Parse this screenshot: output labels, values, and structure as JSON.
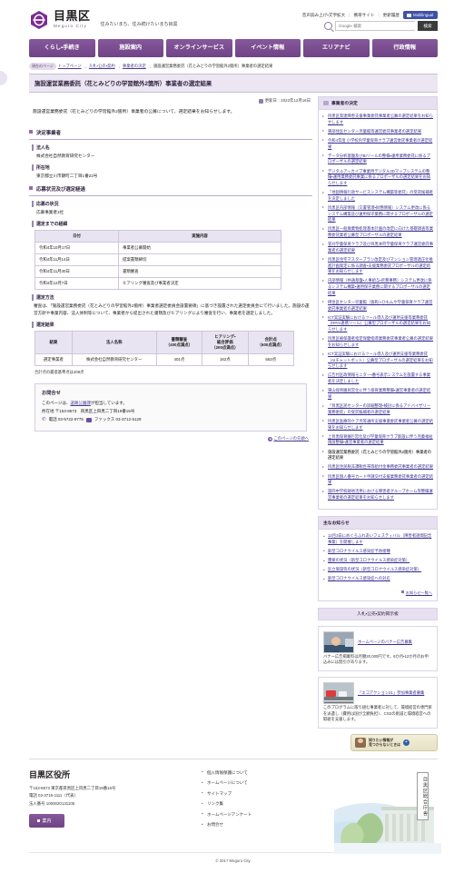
{
  "header": {
    "logo_ja": "目黒区",
    "logo_en": "Meguro City",
    "tagline": "住みたいまち、住み続けたいまち目黒",
    "utils": [
      "音声読み上げ・文字拡大",
      "携帯サイト",
      "更新履歴"
    ],
    "multilingual_label": "Multilingual",
    "search_placeholder": "Google 検索",
    "search_button": "検索"
  },
  "gnav": [
    "くらし・手続き",
    "施設案内",
    "オンラインサービス",
    "イベント情報",
    "エリアナビ",
    "行政情報"
  ],
  "breadcrumb": {
    "badge": "現在のページ",
    "items": [
      "トップページ",
      "入札・公売・契約",
      "事業者の決定"
    ],
    "current": "施設運営業務委託（花とみどりの学習館外2箇所）事業者の選定結果"
  },
  "page_title": "施設運営業務委託（花とみどりの学習館外2箇所）事業者の選定結果",
  "main": {
    "updated_label": "更新日：2022年12月16日",
    "lead": "施設運営業務委託（花とみどりの学習館外2箇所）事業者の公募について、選定結果をお知らせします。",
    "section1_title": "決定事業者",
    "corp_name_label": "法人名",
    "corp_name_value": "株式会社自然教育研究センター",
    "address_label": "所在地",
    "address_value": "東京都立川市錦町二丁目1番22号",
    "section2_title": "応募状況及び選定経過",
    "apply_label": "応募の状況",
    "apply_value": "応募事業者1社",
    "schedule_label": "選定までの経緯",
    "schedule_headers": [
      "日付",
      "実施内容"
    ],
    "schedule_rows": [
      [
        "令和4年10月17日",
        "事業者公募開始"
      ],
      [
        "令和4年11月14日",
        "提案書類締切"
      ],
      [
        "令和4年11月30日",
        "書類審査"
      ],
      [
        "令和4年12月7日",
        "ヒアリング審査及び事業者決定"
      ]
    ],
    "method_label": "選定方法",
    "method_text": "審査は、「施設運営業務委託（花とみどりの学習館外2箇所）事業者選定委員会設置要領」に基づき設置された選定委員会にて行いました。施設の運営方針や事業内容、法人体制等について、事業者から提出された書類及びヒアリングにより審査を行い、事業者を選定しました。",
    "result_label": "選定結果",
    "result_headers": [
      "結果",
      "法人名称",
      "書類審査\n（400点満点）",
      "ヒアリング・\n総合評価\n（200点満点）",
      "合計点\n（600点満点）"
    ],
    "result_row": [
      "選定事業者",
      "株式会社自然教育研究センター",
      "401点",
      "162点",
      "563点"
    ],
    "result_note": "合計点の最低基準点は408点",
    "contact_title": "お問合せ",
    "contact_line1_pre": "このページは、",
    "contact_link": "道路公園課",
    "contact_line1_post": "が担当しています。",
    "contact_address": "所在地 〒153-8573　目黒区上目黒二丁目19番15号",
    "contact_tel": "電話 03-5722-9775",
    "contact_fax": "ファックス 03-3712-5129",
    "page_top": "このページの先頭へ"
  },
  "sidebar": {
    "box1_title": "事業者の決定",
    "box1_links": [
      "目黒区発達障害支援事業委託事業者公募の選定結果をお知らせします",
      "東部住区センター児童館等運営委託事業者の選定結果",
      "令和4年度 小学校内学童保育クラブ運営委託事業者の選定結果",
      "データ分析基盤及びBIツールの整備・運用業務委託に係るプロポーザルの選定結果",
      "デジタルアーカイブ事業用デジタル3Dマップシステムの整備・運用業務委託事業に係るプロポーザルの選定結果をお知らせします",
      "「地図情報行政サービスシステム構築等委託」の受託候補者を決定しました",
      "目黒区内部情報（文書管理・財務情報）システム更改に係るシステム構築及び運用保守業務に関するプロポーザルの選定結果",
      "目黒区一般廃棄物処理基本計画の改定に向けた基礎調査等業務委託業者公募型プロポーザルの選定結果",
      "菅刈学童保育クラブ及び目黒本町学童保育クラブ運営委託事業者の選定結果",
      "目黒区住宅マスタープラン改定及びマンション管理適正化推進計画策定に係る調査・支援業務委託プロポーザルの選定結果をお知らせします",
      "内部情報（共通基盤・人事給与・庶務事務）システム更改に係るシステム構築・運用保守業務に関するプロポーザルの選定結果",
      "碑住区センター児童館（仮称）・ひもんや学童保育クラブ運営委託事業者の選定結果",
      "ICT実証実験におけるツール導入及び運用支援等業務委託（RPA・連携ツール）公募型プロポーザルの選定結果をお知らせします",
      "目黒区被保護者指定保健指導業務委託事業者公募の選定結果をお知らせします",
      "ICT実証実験におけるツール導入及び運用支援等業務委託（AIチャットボット）公募型プロポーザルの選定結果をお知らせします",
      "広告付区政情報モニター・番号表示システムを設置する事業者を決定しました",
      "東山保育園民営化に伴う保育業務整備・運営事業者の選定結果",
      "「目黒区民センターの詳細整理・検討に係るアドバイザリー業務委託」の受託候補者の選定結果",
      "目黒区医療的ケア児等通所支援事業委託事業者公募の選定結果をお知らせします",
      "上目黒保育園민営化及び学童保育クラブ新設に伴う児童福祉施設整備・運営事業者の選定結果",
      "施設運営業務委託（花とみどりの学習館外2箇所）事業者の選定結果",
      "目黒区住民税非課税世帯等給付金事務委託事業者の選定結果",
      "目黒区個人番号カード申請交付支援業務委託事業者の選定結果",
      "第四中学校跡地活用における障害者グループホーム等整備運営事業者の選定結果をお知らせします"
    ],
    "box2_title": "主なお知らせ",
    "box2_links": [
      "12月3日にめぐろふれあいフェスティバル（障害者週間記念事業）を開催します",
      "新型コロナウイルス感染症予防接種",
      "墨蒙の状況（新型コロナウイルス感染症対策）",
      "区立施設等の状況（新型コロナウイルス感染症対策）",
      "新型コロナウイルス感染症への対応"
    ],
    "box2_more": "お知らせ一覧へ",
    "ad_title": "入札・公売・契約掲示板",
    "ads": [
      {
        "link": "ホームページのバナー広告募集",
        "desc": "バナー広告掲載料は月額20,000円です。6か月・12か月のお申込みには割引があります。"
      },
      {
        "link": "「エコアクション21」参加事業者募集",
        "desc": "このプログラムに取り組む事業者に対して、環境経営の専門家を派遣し（費用は国が全額負担）、CO2の削減と環境経営への取組を支援します。"
      }
    ],
    "help_line1": "知りたい情報が",
    "help_line2": "見つからないときは"
  },
  "footer": {
    "office_name": "目黒区役所",
    "address": "〒153-8573 東京都目黒区上目黒二丁目19番15号",
    "tel": "電話 03-3715-1111（代表）",
    "corp_number": "法人番号 1000020131105",
    "button": "案内",
    "links": [
      "個人情報保護について",
      "ホームページについて",
      "サイトマップ",
      "リンク集",
      "ホームページアンケート",
      "お問合せ"
    ],
    "building_label": "目黒区総合庁舎",
    "copyright": "© 2017 Meguro City."
  }
}
